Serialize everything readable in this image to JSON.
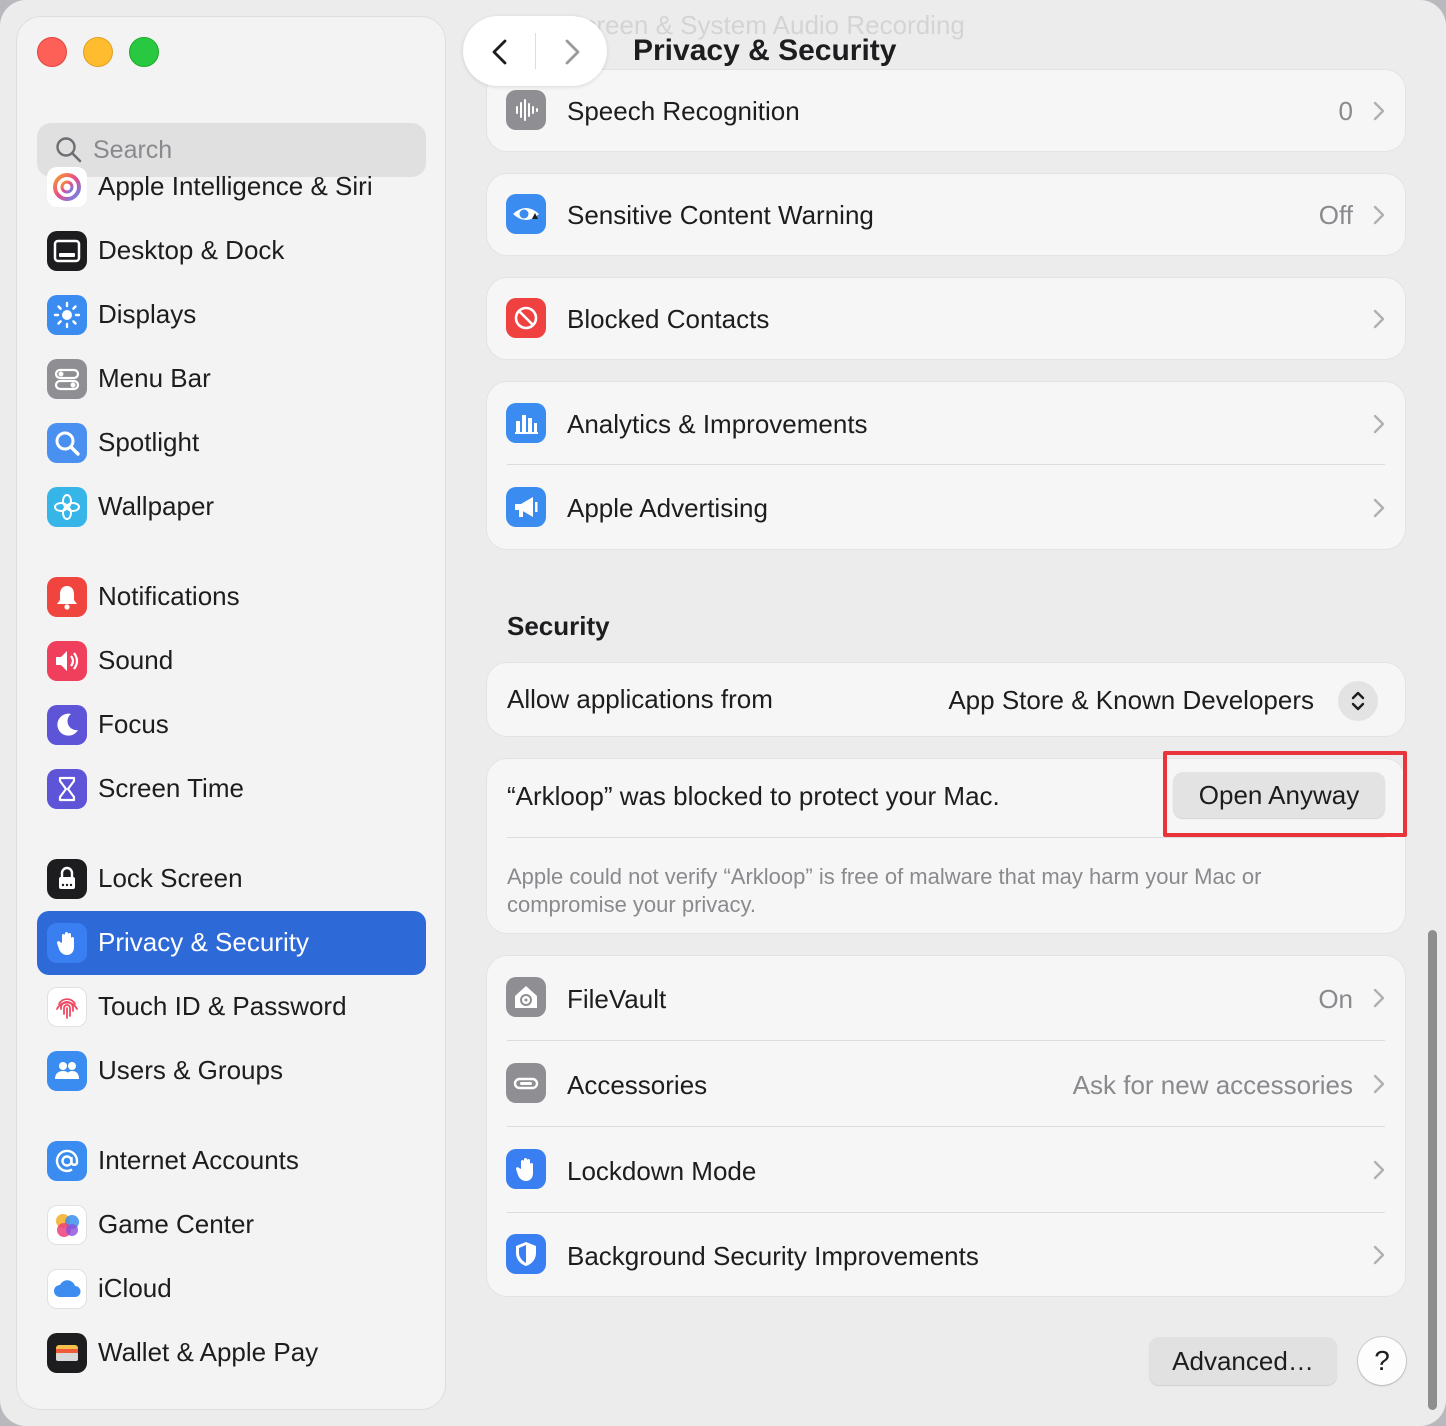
{
  "window": {
    "title": "Privacy & Security"
  },
  "sidebar": {
    "search_placeholder": "Search",
    "items": [
      {
        "label": "Apple Intelligence & Siri",
        "icon": "apple-intelligence-icon"
      },
      {
        "label": "Desktop & Dock",
        "icon": "desktop-dock-icon"
      },
      {
        "label": "Displays",
        "icon": "displays-icon"
      },
      {
        "label": "Menu Bar",
        "icon": "menu-bar-icon"
      },
      {
        "label": "Spotlight",
        "icon": "spotlight-icon"
      },
      {
        "label": "Wallpaper",
        "icon": "wallpaper-icon"
      },
      {
        "label": "Notifications",
        "icon": "notifications-icon"
      },
      {
        "label": "Sound",
        "icon": "sound-icon"
      },
      {
        "label": "Focus",
        "icon": "focus-icon"
      },
      {
        "label": "Screen Time",
        "icon": "screen-time-icon"
      },
      {
        "label": "Lock Screen",
        "icon": "lock-screen-icon"
      },
      {
        "label": "Privacy & Security",
        "icon": "privacy-hand-icon",
        "selected": true
      },
      {
        "label": "Touch ID & Password",
        "icon": "fingerprint-icon"
      },
      {
        "label": "Users & Groups",
        "icon": "users-icon"
      },
      {
        "label": "Internet Accounts",
        "icon": "at-sign-icon"
      },
      {
        "label": "Game Center",
        "icon": "game-center-icon"
      },
      {
        "label": "iCloud",
        "icon": "icloud-icon"
      },
      {
        "label": "Wallet & Apple Pay",
        "icon": "wallet-icon"
      }
    ]
  },
  "main": {
    "ghost_row": "Screen & System Audio Recording",
    "privacy_rows": [
      {
        "label": "Speech Recognition",
        "value": "0",
        "icon": "speech-waveform-icon"
      },
      {
        "label": "Sensitive Content Warning",
        "value": "Off",
        "icon": "sensitive-eye-icon"
      },
      {
        "label": "Blocked Contacts",
        "value": "",
        "icon": "blocked-icon"
      },
      {
        "label": "Analytics & Improvements",
        "value": "",
        "icon": "analytics-icon"
      },
      {
        "label": "Apple Advertising",
        "value": "",
        "icon": "advertising-icon"
      }
    ],
    "security": {
      "section_title": "Security",
      "allow_label": "Allow applications from",
      "allow_value": "App Store & Known Developers",
      "blocked_message": "“Arkloop” was blocked to protect your Mac.",
      "open_anyway": "Open Anyway",
      "note": "Apple could not verify “Arkloop” is free of malware that may harm your Mac or compromise your privacy."
    },
    "security_rows": [
      {
        "label": "FileVault",
        "value": "On",
        "icon": "filevault-icon"
      },
      {
        "label": "Accessories",
        "value": "Ask for new accessories",
        "icon": "accessories-icon"
      },
      {
        "label": "Lockdown Mode",
        "value": "",
        "icon": "lockdown-hand-icon"
      },
      {
        "label": "Background Security Improvements",
        "value": "",
        "icon": "shield-icon"
      }
    ],
    "advanced_button": "Advanced…",
    "help_button": "?"
  },
  "colors": {
    "accent": "#2d6ad7",
    "highlight": "#e8343a"
  }
}
